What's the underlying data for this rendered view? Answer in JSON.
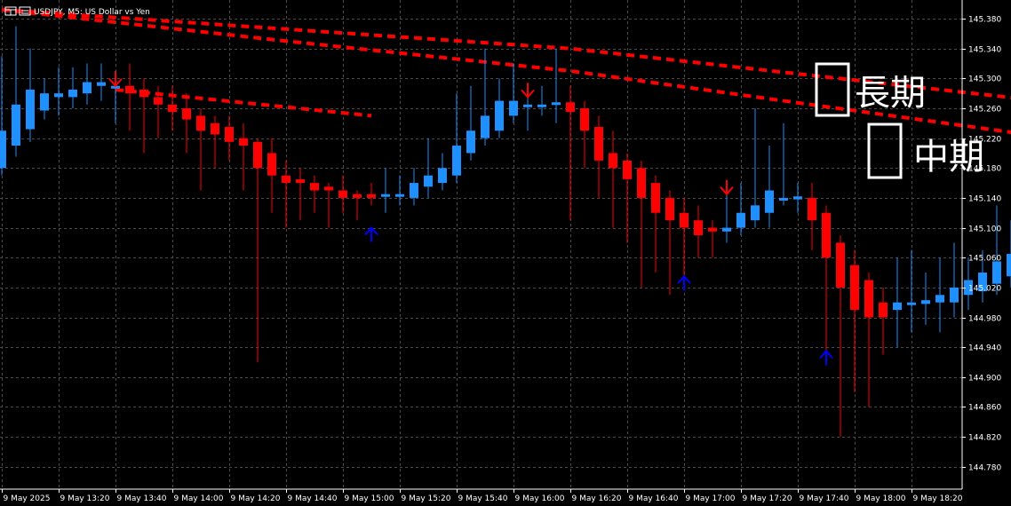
{
  "window": {
    "title": "USDJPY, M5:  US Dollar vs Yen"
  },
  "icons": {
    "chart_icon": "chart-window-icon"
  },
  "colors": {
    "background": "#000000",
    "grid": "#4a4a4a",
    "axis": "#ffffff",
    "bull": "#1e90ff",
    "bear": "#ff0000",
    "ma": "#ff0000",
    "arrow_up": "#0000ff",
    "arrow_down": "#ff0000",
    "legend_box": "#ffffff"
  },
  "legend": [
    {
      "label": "長期"
    },
    {
      "label": "中期"
    }
  ],
  "chart_data": {
    "type": "candlestick",
    "symbol": "USDJPY",
    "timeframe": "M5",
    "ylim": [
      144.75,
      145.405
    ],
    "y_ticks": [
      "145.380",
      "145.340",
      "145.300",
      "145.260",
      "145.220",
      "145.180",
      "145.140",
      "145.100",
      "145.060",
      "145.020",
      "144.980",
      "144.940",
      "144.900",
      "144.860",
      "144.820",
      "144.780"
    ],
    "x_ticks": [
      "9 May 2025",
      "9 May 13:20",
      "9 May 13:40",
      "9 May 14:00",
      "9 May 14:20",
      "9 May 14:40",
      "9 May 15:00",
      "9 May 15:20",
      "9 May 15:40",
      "9 May 16:00",
      "9 May 16:20",
      "9 May 16:40",
      "9 May 17:00",
      "9 May 17:20",
      "9 May 17:40",
      "9 May 18:00",
      "9 May 18:20"
    ],
    "candles": [
      {
        "o": 145.18,
        "h": 145.33,
        "l": 145.17,
        "c": 145.23
      },
      {
        "o": 145.21,
        "h": 145.37,
        "l": 145.195,
        "c": 145.265
      },
      {
        "o": 145.232,
        "h": 145.34,
        "l": 145.215,
        "c": 145.285
      },
      {
        "o": 145.257,
        "h": 145.3,
        "l": 145.245,
        "c": 145.28
      },
      {
        "o": 145.275,
        "h": 145.315,
        "l": 145.25,
        "c": 145.28
      },
      {
        "o": 145.275,
        "h": 145.315,
        "l": 145.26,
        "c": 145.285
      },
      {
        "o": 145.28,
        "h": 145.32,
        "l": 145.265,
        "c": 145.295
      },
      {
        "o": 145.29,
        "h": 145.32,
        "l": 145.27,
        "c": 145.295
      },
      {
        "o": 145.29,
        "h": 145.31,
        "l": 145.24,
        "c": 145.29
      },
      {
        "o": 145.29,
        "h": 145.32,
        "l": 145.23,
        "c": 145.28
      },
      {
        "o": 145.285,
        "h": 145.3,
        "l": 145.2,
        "c": 145.275
      },
      {
        "o": 145.275,
        "h": 145.29,
        "l": 145.22,
        "c": 145.265
      },
      {
        "o": 145.265,
        "h": 145.29,
        "l": 145.23,
        "c": 145.255
      },
      {
        "o": 145.26,
        "h": 145.28,
        "l": 145.2,
        "c": 145.245
      },
      {
        "o": 145.25,
        "h": 145.26,
        "l": 145.15,
        "c": 145.23
      },
      {
        "o": 145.24,
        "h": 145.25,
        "l": 145.18,
        "c": 145.225
      },
      {
        "o": 145.235,
        "h": 145.25,
        "l": 145.19,
        "c": 145.215
      },
      {
        "o": 145.22,
        "h": 145.24,
        "l": 145.15,
        "c": 145.21
      },
      {
        "o": 145.215,
        "h": 145.22,
        "l": 144.92,
        "c": 145.18
      },
      {
        "o": 145.2,
        "h": 145.22,
        "l": 145.12,
        "c": 145.17
      },
      {
        "o": 145.17,
        "h": 145.19,
        "l": 145.1,
        "c": 145.16
      },
      {
        "o": 145.165,
        "h": 145.18,
        "l": 145.11,
        "c": 145.16
      },
      {
        "o": 145.16,
        "h": 145.17,
        "l": 145.12,
        "c": 145.15
      },
      {
        "o": 145.155,
        "h": 145.16,
        "l": 145.1,
        "c": 145.15
      },
      {
        "o": 145.15,
        "h": 145.17,
        "l": 145.12,
        "c": 145.14
      },
      {
        "o": 145.145,
        "h": 145.15,
        "l": 145.11,
        "c": 145.14
      },
      {
        "o": 145.145,
        "h": 145.16,
        "l": 145.13,
        "c": 145.14
      },
      {
        "o": 145.142,
        "h": 145.18,
        "l": 145.12,
        "c": 145.145
      },
      {
        "o": 145.143,
        "h": 145.17,
        "l": 145.13,
        "c": 145.145
      },
      {
        "o": 145.14,
        "h": 145.18,
        "l": 145.13,
        "c": 145.16
      },
      {
        "o": 145.155,
        "h": 145.22,
        "l": 145.14,
        "c": 145.17
      },
      {
        "o": 145.16,
        "h": 145.2,
        "l": 145.15,
        "c": 145.18
      },
      {
        "o": 145.17,
        "h": 145.28,
        "l": 145.16,
        "c": 145.21
      },
      {
        "o": 145.2,
        "h": 145.29,
        "l": 145.19,
        "c": 145.23
      },
      {
        "o": 145.22,
        "h": 145.34,
        "l": 145.21,
        "c": 145.25
      },
      {
        "o": 145.23,
        "h": 145.3,
        "l": 145.22,
        "c": 145.27
      },
      {
        "o": 145.25,
        "h": 145.32,
        "l": 145.24,
        "c": 145.27
      },
      {
        "o": 145.262,
        "h": 145.29,
        "l": 145.23,
        "c": 145.265
      },
      {
        "o": 145.262,
        "h": 145.29,
        "l": 145.25,
        "c": 145.265
      },
      {
        "o": 145.265,
        "h": 145.34,
        "l": 145.24,
        "c": 145.268
      },
      {
        "o": 145.268,
        "h": 145.29,
        "l": 145.11,
        "c": 145.255
      },
      {
        "o": 145.26,
        "h": 145.27,
        "l": 145.18,
        "c": 145.23
      },
      {
        "o": 145.235,
        "h": 145.25,
        "l": 145.14,
        "c": 145.19
      },
      {
        "o": 145.2,
        "h": 145.23,
        "l": 145.1,
        "c": 145.18
      },
      {
        "o": 145.19,
        "h": 145.2,
        "l": 145.08,
        "c": 145.165
      },
      {
        "o": 145.18,
        "h": 145.19,
        "l": 145.02,
        "c": 145.14
      },
      {
        "o": 145.16,
        "h": 145.17,
        "l": 145.04,
        "c": 145.12
      },
      {
        "o": 145.14,
        "h": 145.15,
        "l": 145.01,
        "c": 145.11
      },
      {
        "o": 145.12,
        "h": 145.14,
        "l": 145.03,
        "c": 145.1
      },
      {
        "o": 145.11,
        "h": 145.13,
        "l": 145.06,
        "c": 145.09
      },
      {
        "o": 145.1,
        "h": 145.11,
        "l": 145.06,
        "c": 145.095
      },
      {
        "o": 145.095,
        "h": 145.15,
        "l": 145.08,
        "c": 145.1
      },
      {
        "o": 145.1,
        "h": 145.16,
        "l": 145.09,
        "c": 145.12
      },
      {
        "o": 145.11,
        "h": 145.26,
        "l": 145.1,
        "c": 145.13
      },
      {
        "o": 145.12,
        "h": 145.21,
        "l": 145.1,
        "c": 145.15
      },
      {
        "o": 145.14,
        "h": 145.24,
        "l": 145.13,
        "c": 145.14
      },
      {
        "o": 145.138,
        "h": 145.16,
        "l": 145.12,
        "c": 145.142
      },
      {
        "o": 145.14,
        "h": 145.16,
        "l": 145.07,
        "c": 145.11
      },
      {
        "o": 145.12,
        "h": 145.13,
        "l": 144.93,
        "c": 145.06
      },
      {
        "o": 145.08,
        "h": 145.09,
        "l": 144.82,
        "c": 145.02
      },
      {
        "o": 145.05,
        "h": 145.07,
        "l": 144.88,
        "c": 144.99
      },
      {
        "o": 145.03,
        "h": 145.04,
        "l": 144.86,
        "c": 144.98
      },
      {
        "o": 145.0,
        "h": 145.02,
        "l": 144.93,
        "c": 144.98
      },
      {
        "o": 144.99,
        "h": 145.06,
        "l": 144.94,
        "c": 145.0
      },
      {
        "o": 144.997,
        "h": 145.07,
        "l": 144.96,
        "c": 145.0
      },
      {
        "o": 144.998,
        "h": 145.04,
        "l": 144.97,
        "c": 145.003
      },
      {
        "o": 145.0,
        "h": 145.06,
        "l": 144.96,
        "c": 145.01
      },
      {
        "o": 145.0,
        "h": 145.08,
        "l": 144.98,
        "c": 145.02
      },
      {
        "o": 145.01,
        "h": 145.06,
        "l": 144.99,
        "c": 145.03
      },
      {
        "o": 145.015,
        "h": 145.07,
        "l": 145.0,
        "c": 145.04
      },
      {
        "o": 145.025,
        "h": 145.13,
        "l": 145.01,
        "c": 145.055
      },
      {
        "o": 145.035,
        "h": 145.11,
        "l": 145.02,
        "c": 145.065
      },
      {
        "o": 145.05,
        "h": 145.14,
        "l": 145.04,
        "c": 145.08
      },
      {
        "o": 145.06,
        "h": 145.18,
        "l": 145.05,
        "c": 145.095
      },
      {
        "o": 145.075,
        "h": 145.19,
        "l": 145.065,
        "c": 145.11
      }
    ],
    "ma_long": [
      [
        0,
        145.392
      ],
      [
        40,
        145.34
      ],
      [
        74,
        145.268
      ]
    ],
    "ma_mid": [
      [
        0,
        145.392
      ],
      [
        20,
        145.35
      ],
      [
        40,
        145.31
      ],
      [
        55,
        145.27
      ],
      [
        74,
        145.22
      ]
    ],
    "ma_short": [
      [
        8,
        145.285
      ],
      [
        26,
        145.25
      ]
    ],
    "arrows_up": [
      {
        "i": 26,
        "y": 145.1
      },
      {
        "i": 48,
        "y": 145.035
      },
      {
        "i": 58,
        "y": 144.935
      }
    ],
    "arrows_down": [
      {
        "i": 8,
        "y": 145.29
      },
      {
        "i": 37,
        "y": 145.275
      },
      {
        "i": 51,
        "y": 145.145
      }
    ]
  }
}
